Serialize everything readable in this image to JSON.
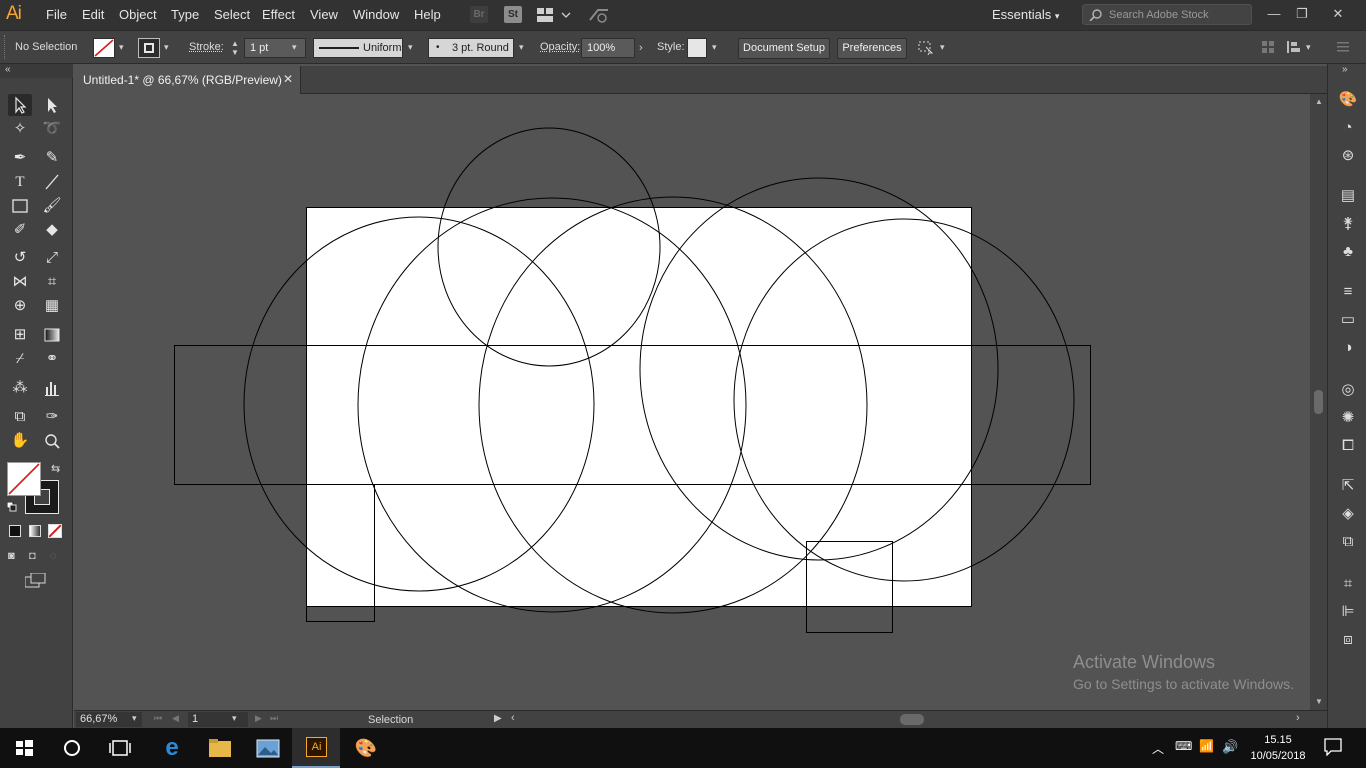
{
  "app": {
    "logo": "Ai",
    "menus": [
      "File",
      "Edit",
      "Object",
      "Type",
      "Select",
      "Effect",
      "View",
      "Window",
      "Help"
    ],
    "bridge_label": "Br",
    "stock_label": "St",
    "workspace": "Essentials",
    "search_placeholder": "Search Adobe Stock",
    "window_controls": [
      "minimize-icon",
      "restore-icon",
      "close-icon"
    ]
  },
  "control_bar": {
    "selection_status": "No Selection",
    "stroke_label": "Stroke:",
    "stroke_weight": "1 pt",
    "stroke_profile": "Uniform",
    "brush": "3 pt. Round",
    "opacity_label": "Opacity:",
    "opacity_value": "100%",
    "style_label": "Style:",
    "document_setup": "Document Setup",
    "preferences": "Preferences"
  },
  "document": {
    "tab_title": "Untitled-1* @ 66,67% (RGB/Preview)",
    "close_glyph": "✕"
  },
  "status_bar": {
    "zoom": "66,67%",
    "artboard_number": "1",
    "current_tool": "Selection"
  },
  "watermark": {
    "line1": "Activate Windows",
    "line2": "Go to Settings to activate Windows."
  },
  "taskbar": {
    "apps": [
      "windows-start-icon",
      "cortana-icon",
      "task-view-icon",
      "edge-icon",
      "file-explorer-icon",
      "photos-icon",
      "illustrator-icon",
      "paint-icon"
    ],
    "illustrator_label": "Ai",
    "time": "15.15",
    "date": "10/05/2018"
  },
  "colors": {
    "accent_orange": "#f7a631",
    "ui_dark": "#323232",
    "panel": "#424242",
    "canvas": "#535353",
    "artboard": "#ffffff",
    "stroke": "#000000"
  }
}
